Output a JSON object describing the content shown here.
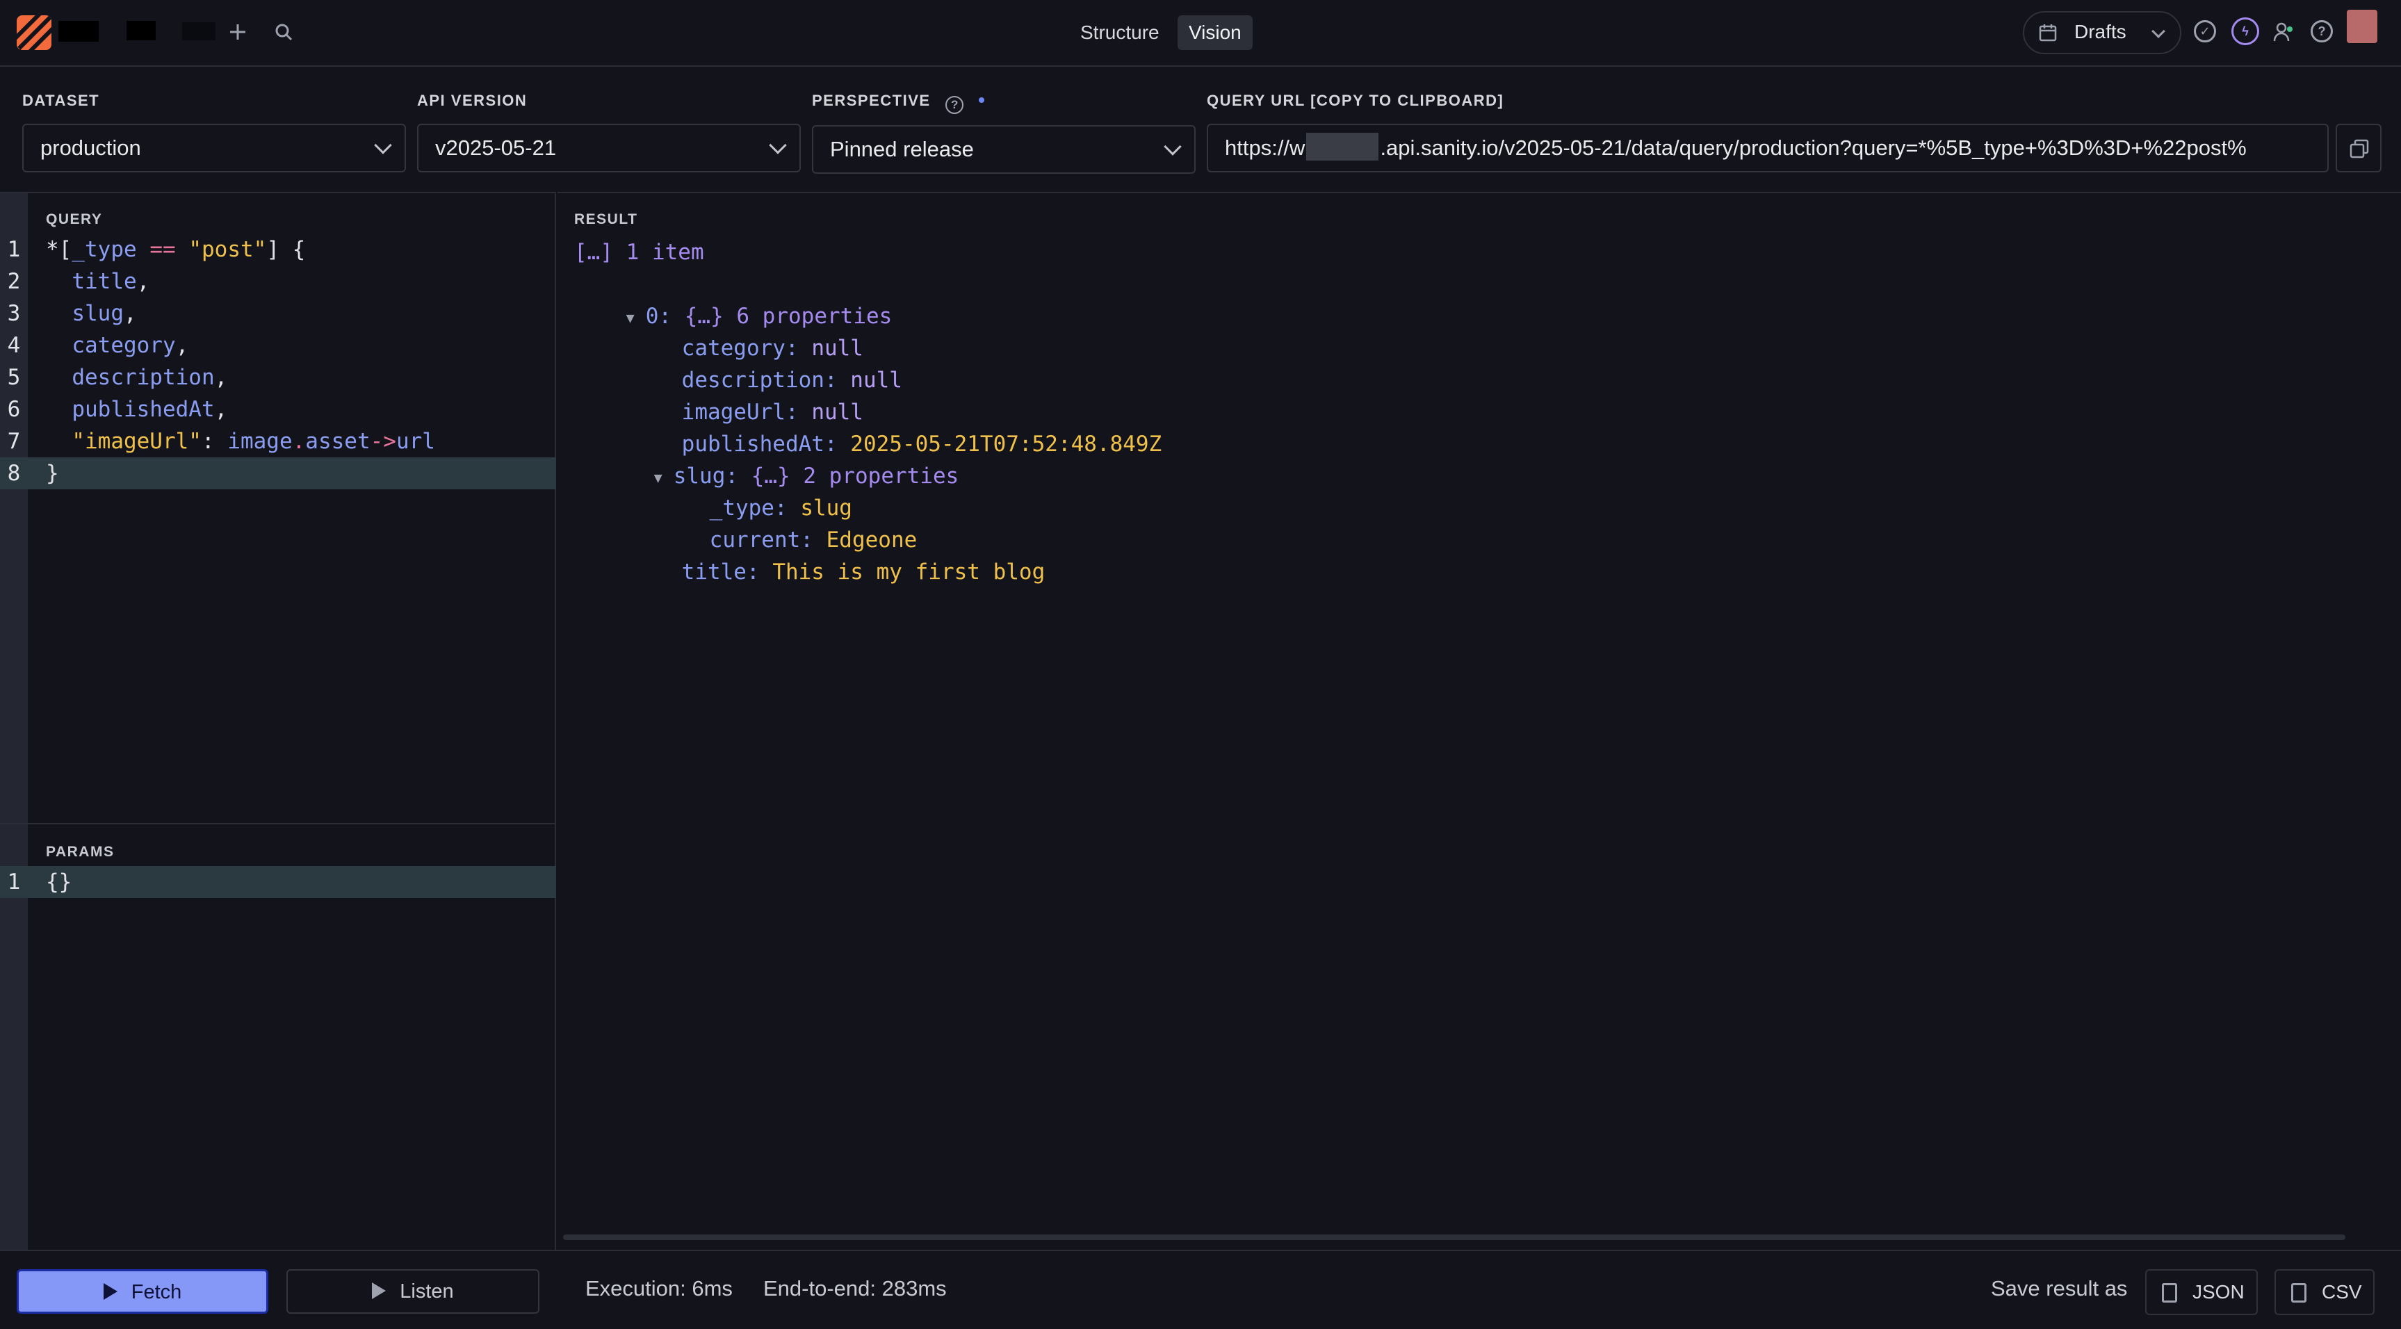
{
  "topbar": {
    "nav": {
      "structure": "Structure",
      "vision": "Vision"
    },
    "perspective_menu": {
      "label": "Drafts"
    },
    "icons": [
      "sanity-logo",
      "plus-icon",
      "search-icon",
      "calendar-icon",
      "chevron-down-icon",
      "check-circle-icon",
      "bolt-circle-icon",
      "people-icon",
      "help-icon",
      "avatar"
    ]
  },
  "config": {
    "dataset": {
      "label": "DATASET",
      "value": "production"
    },
    "api_version": {
      "label": "API VERSION",
      "value": "v2025-05-21"
    },
    "perspective": {
      "label": "PERSPECTIVE",
      "value": "Pinned release"
    },
    "query_url": {
      "label": "QUERY URL [COPY TO CLIPBOARD]",
      "value_start": "https://w",
      "value_end": ".api.sanity.io/v2025-05-21/data/query/production?query=*%5B_type+%3D%3D+%22post%"
    }
  },
  "query": {
    "label": "QUERY",
    "lines": [
      {
        "n": "1",
        "parts": [
          [
            "c-op",
            "*["
          ],
          [
            "c-attr",
            "_type"
          ],
          [
            "c-op",
            " "
          ],
          [
            "c-kw",
            "=="
          ],
          [
            "c-op",
            " "
          ],
          [
            "c-str",
            "\"post\""
          ],
          [
            "c-op",
            "] {"
          ]
        ]
      },
      {
        "n": "2",
        "parts": [
          [
            "c-op",
            "  "
          ],
          [
            "c-attr",
            "title"
          ],
          [
            "c-op",
            ","
          ]
        ]
      },
      {
        "n": "3",
        "parts": [
          [
            "c-op",
            "  "
          ],
          [
            "c-attr",
            "slug"
          ],
          [
            "c-op",
            ","
          ]
        ]
      },
      {
        "n": "4",
        "parts": [
          [
            "c-op",
            "  "
          ],
          [
            "c-attr",
            "category"
          ],
          [
            "c-op",
            ","
          ]
        ]
      },
      {
        "n": "5",
        "parts": [
          [
            "c-op",
            "  "
          ],
          [
            "c-attr",
            "description"
          ],
          [
            "c-op",
            ","
          ]
        ]
      },
      {
        "n": "6",
        "parts": [
          [
            "c-op",
            "  "
          ],
          [
            "c-attr",
            "publishedAt"
          ],
          [
            "c-op",
            ","
          ]
        ]
      },
      {
        "n": "7",
        "parts": [
          [
            "c-op",
            "  "
          ],
          [
            "c-str",
            "\"imageUrl\""
          ],
          [
            "c-op",
            ": "
          ],
          [
            "c-attr",
            "image"
          ],
          [
            "c-kw",
            "."
          ],
          [
            "c-attr",
            "asset"
          ],
          [
            "c-kw",
            "->"
          ],
          [
            "c-attr",
            "url"
          ]
        ]
      },
      {
        "n": "8",
        "parts": [
          [
            "c-op",
            "}"
          ]
        ]
      }
    ]
  },
  "params": {
    "label": "PARAMS",
    "lines": [
      {
        "n": "1",
        "parts": [
          [
            "c-op",
            "{}"
          ]
        ]
      }
    ]
  },
  "result": {
    "label": "RESULT",
    "summary": "[…] 1 item",
    "item0": {
      "key": "0:",
      "meta": "{…} 6 properties"
    },
    "fields": {
      "category": {
        "key": "category:",
        "value": "null"
      },
      "description": {
        "key": "description:",
        "value": "null"
      },
      "imageUrl": {
        "key": "imageUrl:",
        "value": "null"
      },
      "publishedAt": {
        "key": "publishedAt:",
        "value": "2025-05-21T07:52:48.849Z"
      },
      "slug": {
        "key": "slug:",
        "meta": "{…} 2 properties"
      },
      "slug_type": {
        "key": "_type:",
        "value": "slug"
      },
      "slug_current": {
        "key": "current:",
        "value": "Edgeone"
      },
      "title": {
        "key": "title:",
        "value": "This is my first blog"
      }
    }
  },
  "footer": {
    "fetch_label": "Fetch",
    "listen_label": "Listen",
    "execution": "Execution: 6ms",
    "end_to_end": "End-to-end: 283ms",
    "save_label": "Save result as",
    "json_label": "JSON",
    "csv_label": "CSV"
  },
  "colors": {
    "accent": "#8597f7",
    "brand": "#f36a3d",
    "string": "#f0c14a",
    "attribute": "#8b9df0"
  }
}
